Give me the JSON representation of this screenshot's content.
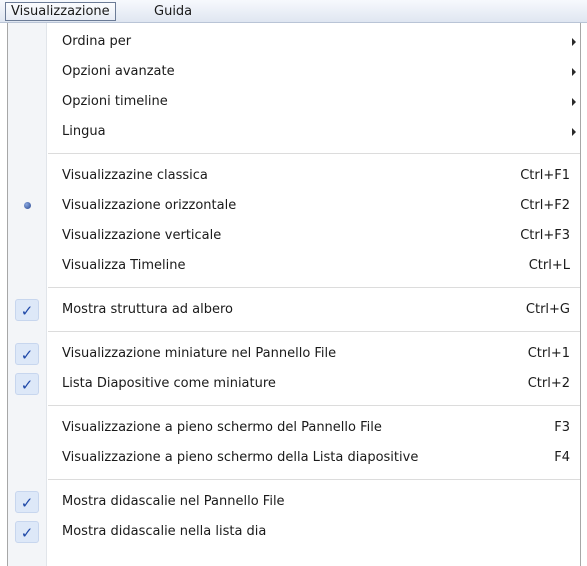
{
  "menubar": {
    "items": [
      {
        "label": "Visualizzazione"
      },
      {
        "label": "Guida"
      }
    ]
  },
  "menu": {
    "items": [
      {
        "label": "Ordina per",
        "shortcut": "",
        "submenu": true,
        "state": ""
      },
      {
        "label": "Opzioni avanzate",
        "shortcut": "",
        "submenu": true,
        "state": ""
      },
      {
        "label": "Opzioni timeline",
        "shortcut": "",
        "submenu": true,
        "state": ""
      },
      {
        "label": "Lingua",
        "shortcut": "",
        "submenu": true,
        "state": ""
      },
      {
        "label": "Visualizzazine classica",
        "shortcut": "Ctrl+F1",
        "submenu": false,
        "state": ""
      },
      {
        "label": "Visualizzazione orizzontale",
        "shortcut": "Ctrl+F2",
        "submenu": false,
        "state": "radio"
      },
      {
        "label": "Visualizzazione verticale",
        "shortcut": "Ctrl+F3",
        "submenu": false,
        "state": ""
      },
      {
        "label": "Visualizza Timeline",
        "shortcut": "Ctrl+L",
        "submenu": false,
        "state": ""
      },
      {
        "label": "Mostra struttura ad albero",
        "shortcut": "Ctrl+G",
        "submenu": false,
        "state": "check"
      },
      {
        "label": "Visualizzazione miniature nel Pannello File",
        "shortcut": "Ctrl+1",
        "submenu": false,
        "state": "check"
      },
      {
        "label": "Lista Diapositive come miniature",
        "shortcut": "Ctrl+2",
        "submenu": false,
        "state": "check"
      },
      {
        "label": "Visualizzazione a pieno schermo del Pannello File",
        "shortcut": "F3",
        "submenu": false,
        "state": ""
      },
      {
        "label": "Visualizzazione a pieno schermo della Lista diapositive",
        "shortcut": "F4",
        "submenu": false,
        "state": ""
      },
      {
        "label": "Mostra didascalie nel Pannello File",
        "shortcut": "",
        "submenu": false,
        "state": "check"
      },
      {
        "label": "Mostra didascalie nella lista dia",
        "shortcut": "",
        "submenu": false,
        "state": "check"
      }
    ],
    "icons": {
      "check": "checkmark-icon",
      "radio": "radio-bullet-icon",
      "submenu": "submenu-arrow-icon"
    }
  }
}
